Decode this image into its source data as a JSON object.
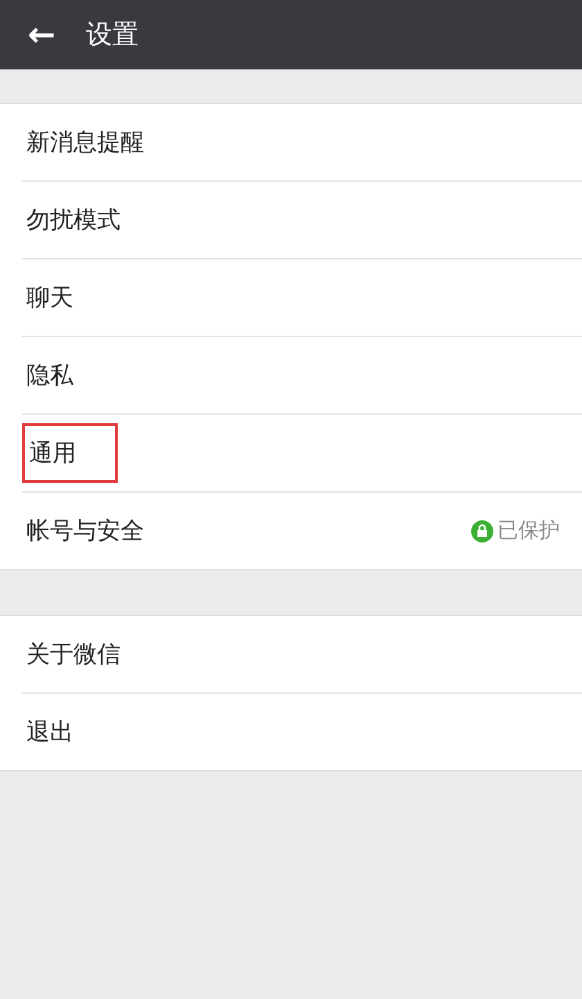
{
  "header": {
    "back_icon": "←",
    "title": "设置"
  },
  "groups": [
    {
      "items": [
        {
          "label": "新消息提醒",
          "highlighted": false
        },
        {
          "label": "勿扰模式",
          "highlighted": false
        },
        {
          "label": "聊天",
          "highlighted": false
        },
        {
          "label": "隐私",
          "highlighted": false
        },
        {
          "label": "通用",
          "highlighted": true
        },
        {
          "label": "帐号与安全",
          "highlighted": false,
          "status": "已保护"
        }
      ]
    },
    {
      "items": [
        {
          "label": "关于微信",
          "highlighted": false
        },
        {
          "label": "退出",
          "highlighted": false
        }
      ]
    }
  ]
}
